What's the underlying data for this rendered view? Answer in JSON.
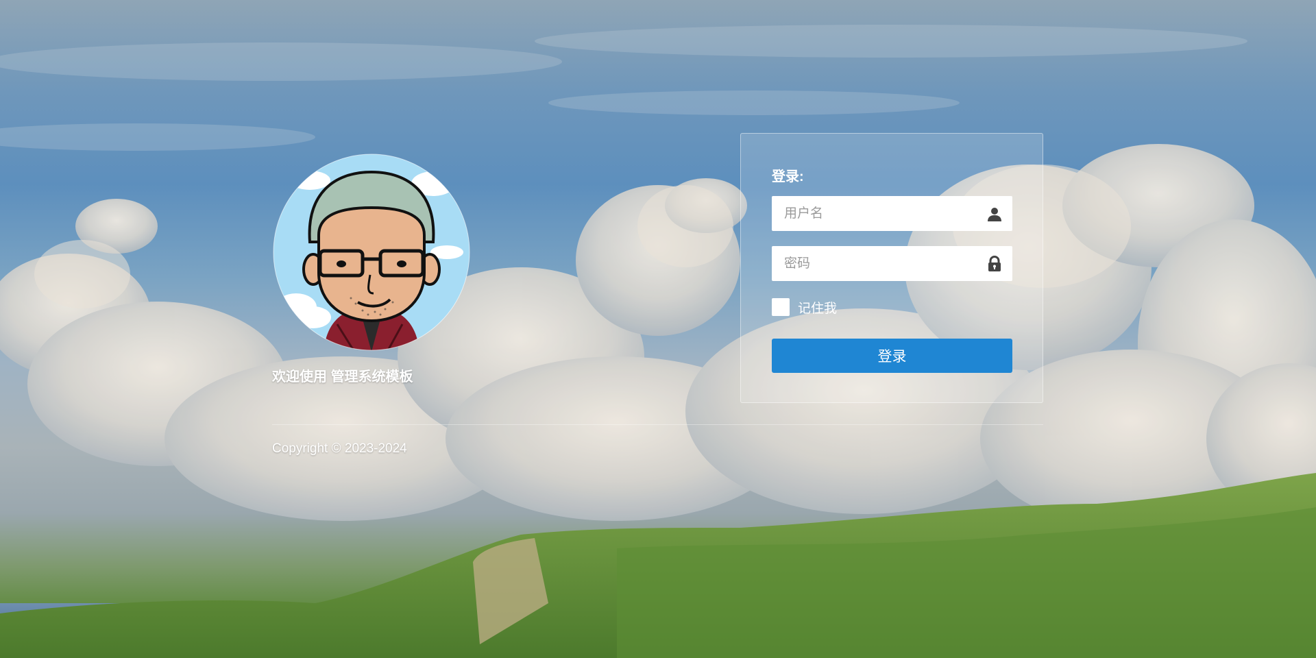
{
  "welcome": {
    "prefix": "欢迎使用",
    "system_name": "管理系统模板"
  },
  "login": {
    "title": "登录:",
    "username_placeholder": "用户名",
    "password_placeholder": "密码",
    "remember_label": "记住我",
    "submit_label": "登录",
    "button_color": "#1f86d3"
  },
  "footer": {
    "copyright": "Copyright © 2023-2024"
  },
  "icons": {
    "username_icon": "user-icon",
    "password_icon": "lock-icon"
  }
}
